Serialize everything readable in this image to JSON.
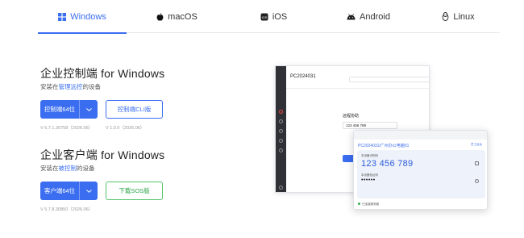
{
  "tabs": [
    {
      "label": "Windows",
      "icon": "windows-icon",
      "active": true
    },
    {
      "label": "macOS",
      "icon": "apple-icon"
    },
    {
      "label": "iOS",
      "icon": "ios-icon"
    },
    {
      "label": "Android",
      "icon": "android-icon"
    },
    {
      "label": "Linux",
      "icon": "linux-icon"
    }
  ],
  "sections": [
    {
      "title": "企业控制端 for Windows",
      "sub_prefix": "安装在",
      "sub_link": "管理远控",
      "sub_suffix": "的设备",
      "primary_label": "控制端64位",
      "secondary_label": "控制端CLI版",
      "versions": [
        "V 6.7.1.30758（2026.06）",
        "V 1.0.0（2026.06）"
      ]
    },
    {
      "title": "企业客户端 for Windows",
      "sub_prefix": "安装在",
      "sub_link": "被控制",
      "sub_suffix": "的设备",
      "primary_label": "客户端64位",
      "secondary_label": "下载SOS版",
      "versions": [
        "V 5.7.8.30850（2026.06）"
      ]
    }
  ],
  "mock": {
    "pc_id": "PC2024031",
    "remote_title": "远程协助",
    "remote_id": "123 456 789"
  },
  "card": {
    "pc": "PC2024031/广州办公电脑01",
    "link": "员工后台",
    "device_id_label": "本设备识别码",
    "device_id": "123 456 789",
    "password_label": "本设备验证码",
    "password": "••••••",
    "status": "已连接服务器"
  },
  "colors": {
    "accent": "#3a6df0",
    "green": "#56c46d"
  }
}
